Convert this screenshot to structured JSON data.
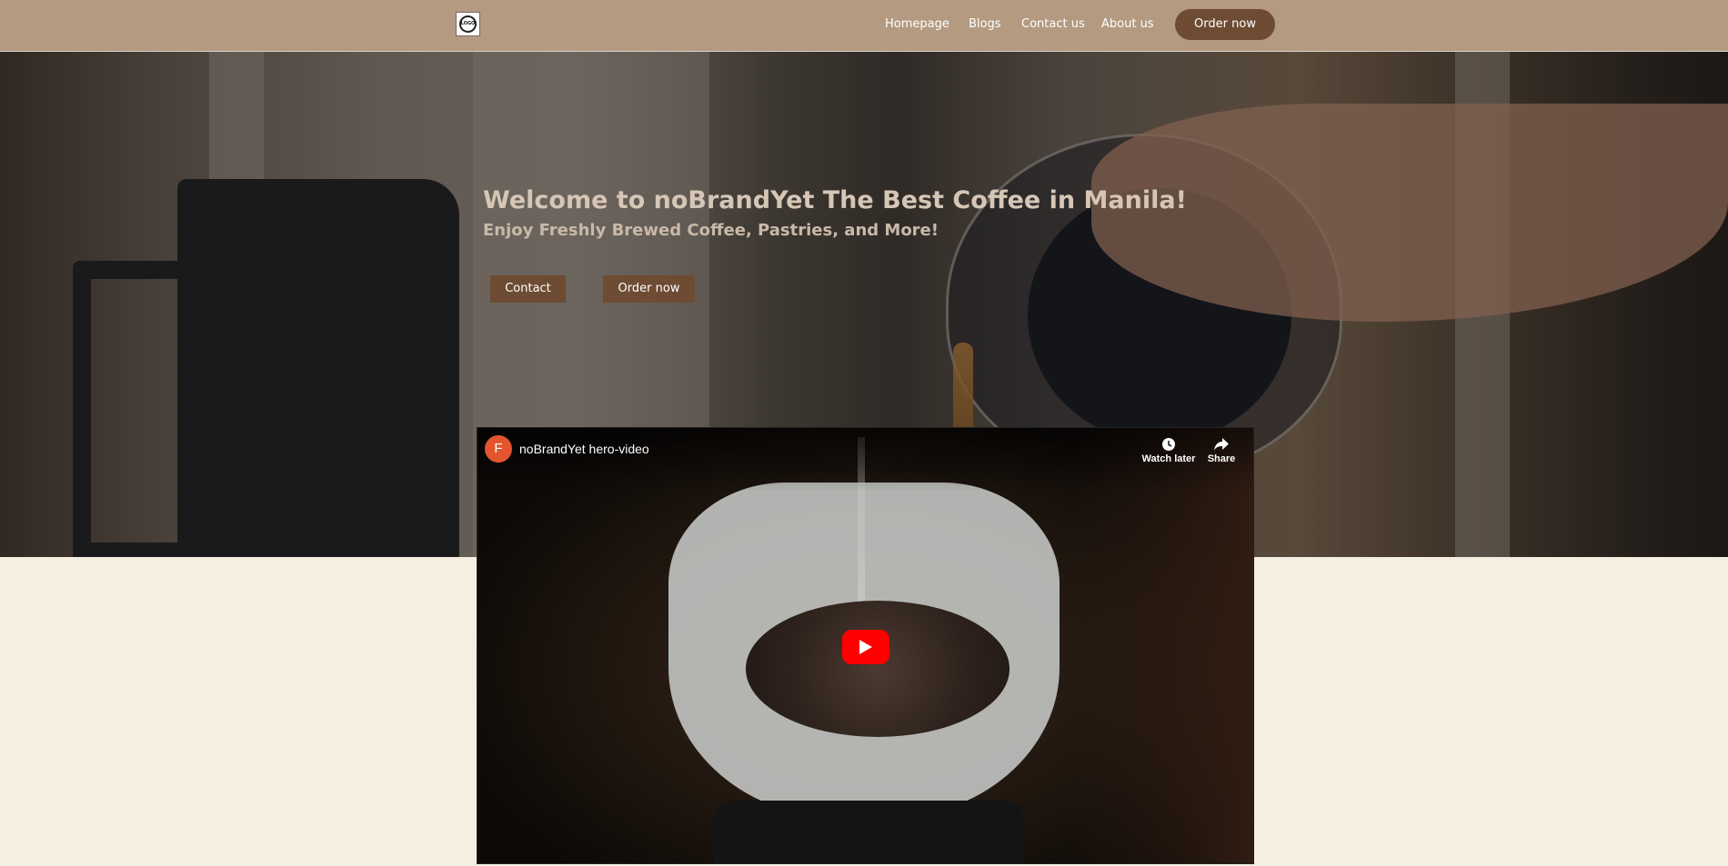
{
  "header": {
    "logo_text": "LOGO",
    "nav": [
      "Homepage",
      "Blogs",
      "Contact us",
      "About us"
    ],
    "order_label": "Order now"
  },
  "hero": {
    "title": "Welcome to noBrandYet The Best Coffee in Manila!",
    "subtitle": "Enjoy Freshly Brewed Coffee, Pastries, and More!",
    "contact_label": "Contact",
    "order_label": "Order now"
  },
  "video": {
    "channel_initial": "F",
    "title": "noBrandYet hero-video",
    "watch_later_label": "Watch later",
    "share_label": "Share",
    "icons": [
      "clock-icon",
      "share-arrow-icon",
      "youtube-play-icon"
    ],
    "play_color": "#ff0000"
  },
  "colors": {
    "header_bg": "#b39a81",
    "accent_brown": "#6d4c33",
    "page_bg": "#f5efe2"
  }
}
